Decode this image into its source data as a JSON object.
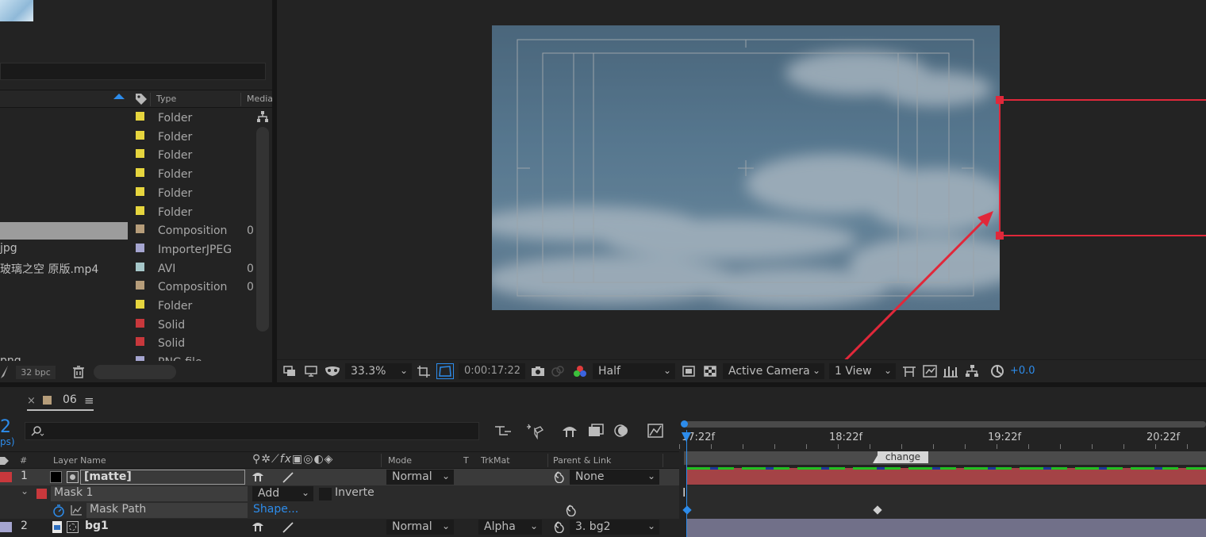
{
  "project": {
    "columns": {
      "type": "Type",
      "media": "Media"
    },
    "rows": [
      {
        "name": "",
        "type": "Folder",
        "color": "#e6d53e",
        "extra": ""
      },
      {
        "name": "",
        "type": "Folder",
        "color": "#e6d53e",
        "extra": ""
      },
      {
        "name": "",
        "type": "Folder",
        "color": "#e6d53e",
        "extra": ""
      },
      {
        "name": "",
        "type": "Folder",
        "color": "#e6d53e",
        "extra": ""
      },
      {
        "name": "",
        "type": "Folder",
        "color": "#e6d53e",
        "extra": ""
      },
      {
        "name": "",
        "type": "Folder",
        "color": "#e6d53e",
        "extra": ""
      },
      {
        "name": "",
        "type": "Composition",
        "color": "#b69d7a",
        "extra": "0",
        "selected": true
      },
      {
        "name": "jpg",
        "type": "ImporterJPEG",
        "color": "#a5a5d0",
        "extra": ""
      },
      {
        "name": "玻璃之空 原版.mp4",
        "type": "AVI",
        "color": "#a6c7c9",
        "extra": "0"
      },
      {
        "name": "",
        "type": "Composition",
        "color": "#b69d7a",
        "extra": "0"
      },
      {
        "name": "",
        "type": "Folder",
        "color": "#e6d53e",
        "extra": ""
      },
      {
        "name": "",
        "type": "Solid",
        "color": "#c8383c",
        "extra": ""
      },
      {
        "name": "",
        "type": "Solid",
        "color": "#c8383c",
        "extra": ""
      },
      {
        "name": "png",
        "type": "PNG file",
        "color": "#a5a5d0",
        "extra": ""
      }
    ],
    "bpc": "32 bpc"
  },
  "viewer": {
    "zoom": "33.3%",
    "timecode": "0:00:17:22",
    "resolution": "Half",
    "camera": "Active Camera",
    "views": "1 View",
    "exposure": "+0.0"
  },
  "timeline": {
    "tab_name": "06",
    "time_big": "2",
    "fps_hint": "ps)",
    "columns": {
      "num": "#",
      "layer_name": "Layer Name",
      "mode": "Mode",
      "t": "T",
      "trkmat": "TrkMat",
      "parent": "Parent & Link"
    },
    "ruler": {
      "t0": "17:22f",
      "t1": "18:22f",
      "t2": "19:22f",
      "t3": "20:22f"
    },
    "marker": "change",
    "layers": [
      {
        "num": "1",
        "name": "[matte]",
        "mode": "Normal",
        "trkmat": "",
        "parent": "None"
      },
      {
        "num": "2",
        "name": "bg1",
        "mode": "Normal",
        "trkmat": "Alpha",
        "parent": "3. bg2"
      }
    ],
    "mask": {
      "name": "Mask 1",
      "mode": "Add",
      "inverted": "Inverte",
      "path_label": "Mask Path",
      "path_value": "Shape..."
    }
  },
  "colors": {
    "accent": "#2d8ceb",
    "annotation": "#e0283a",
    "matte_bar": "#a44346",
    "bg_bar": "#717089"
  }
}
